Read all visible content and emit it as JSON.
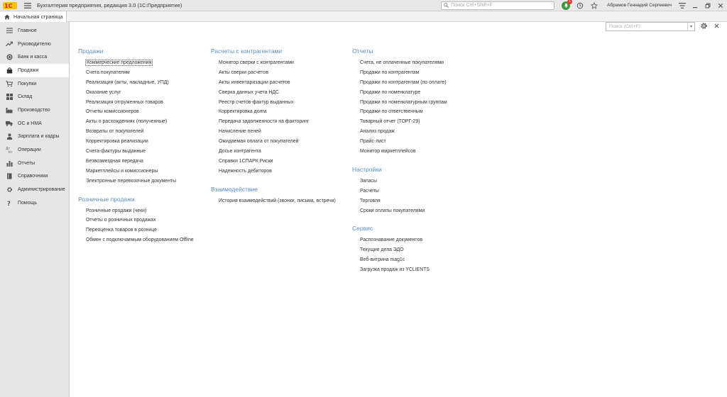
{
  "app": {
    "title": "Бухгалтерия предприятия, редакция 3.0  (1С:Предприятие)",
    "search_placeholder": "Поиск Ctrl+Shift+F",
    "notifications_count": "1",
    "username": "Абрамов Геннадий Сергеевич"
  },
  "tabs": {
    "home": "Начальная страница"
  },
  "sidebar": {
    "items": [
      {
        "label": "Главное",
        "icon": "menu-icon"
      },
      {
        "label": "Руководителю",
        "icon": "trend-icon"
      },
      {
        "label": "Банк и касса",
        "icon": "coin-icon"
      },
      {
        "label": "Продажи",
        "icon": "bag-icon"
      },
      {
        "label": "Покупки",
        "icon": "cart-icon"
      },
      {
        "label": "Склад",
        "icon": "grid-icon"
      },
      {
        "label": "Производство",
        "icon": "factory-icon"
      },
      {
        "label": "ОС и НМА",
        "icon": "truck-icon"
      },
      {
        "label": "Зарплата и кадры",
        "icon": "person-icon"
      },
      {
        "label": "Операции",
        "icon": "operations-icon"
      },
      {
        "label": "Отчеты",
        "icon": "bar-chart-icon"
      },
      {
        "label": "Справочники",
        "icon": "book-icon"
      },
      {
        "label": "Администрирование",
        "icon": "gear-icon"
      },
      {
        "label": "Помощь",
        "icon": "help-icon"
      }
    ]
  },
  "main": {
    "search_placeholder": "Поиск (Ctrl+F)",
    "col1": {
      "sales": {
        "title": "Продажи",
        "links": [
          "Коммерческие предложения",
          "Счета покупателям",
          "Реализация (акты, накладные, УПД)",
          "Оказание услуг",
          "Реализация отгруженных товаров",
          "Отчеты комиссионеров",
          "Акты о расхождениях (полученные)",
          "Возвраты от покупателей",
          "Корректировка реализации",
          "Счета-фактуры выданные",
          "Безвозмездная передача",
          "Маркетплейсы и комиссионеры",
          "Электронные перевозочные документы"
        ]
      },
      "retail": {
        "title": "Розничные продажи",
        "links": [
          "Розничные продажи (чеки)",
          "Отчеты о розничных продажах",
          "Переоценка товаров в рознице",
          "Обмен с подключаемым оборудованием Offline"
        ]
      }
    },
    "col2": {
      "settlements": {
        "title": "Расчеты с контрагентами",
        "links": [
          "Монитор сверки с контрагентами",
          "Акты сверки расчетов",
          "Акты инвентаризации расчетов",
          "Сверка данных учета НДС",
          "Реестр счетов-фактур выданных",
          "Корректировка долга",
          "Передача задолженности на факторинг",
          "Начисление пеней",
          "Ожидаемая оплата от покупателей",
          "Досье контрагента",
          "Справки 1СПАРК Риски",
          "Надежность дебиторов"
        ]
      },
      "interaction": {
        "title": "Взаимодействие",
        "links": [
          "История взаимодействий (звонки, письма, встречи)"
        ]
      }
    },
    "col3": {
      "reports": {
        "title": "Отчеты",
        "links": [
          "Счета, не оплаченные покупателями",
          "Продажи по контрагентам",
          "Продажи по контрагентам (по оплате)",
          "Продажи по номенклатуре",
          "Продажи по номенклатурным группам",
          "Продажи по ответственным",
          "Товарный отчет (ТОРГ-29)",
          "Анализ продаж",
          "Прайс-лист",
          "Монитор маркетплейсов"
        ]
      },
      "settings": {
        "title": "Настройки",
        "links": [
          "Запасы",
          "Расчеты",
          "Торговля",
          "Сроки оплаты покупателями"
        ]
      },
      "service": {
        "title": "Сервис",
        "links": [
          "Распознавание документов",
          "Текущие дела ЭДО",
          "Веб-витрина mag1c",
          "Загрузка продаж из YCLIENTS"
        ]
      }
    }
  },
  "colors": {
    "section_title": "#5b8fbf",
    "sidebar_bg": "#e6e6e6",
    "active_item_bg": "#ffffff",
    "logo_red": "#d6201a",
    "logo_yellow": "#f5c400"
  }
}
